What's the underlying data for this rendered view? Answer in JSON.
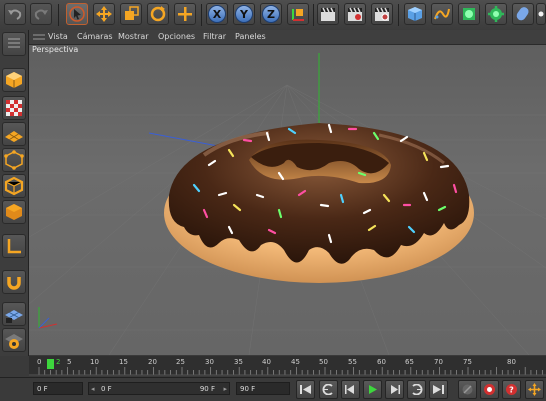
{
  "menu": {
    "items": [
      "Vista",
      "Cámaras",
      "Mostrar",
      "Opciones",
      "Filtrar",
      "Paneles"
    ]
  },
  "viewport": {
    "label": "Perspectiva"
  },
  "toolbar": {
    "axis_x": "X",
    "axis_y": "Y",
    "axis_z": "Z"
  },
  "timeline": {
    "ticks": [
      "0",
      "5",
      "10",
      "15",
      "20",
      "25",
      "30",
      "35",
      "40",
      "45",
      "50",
      "55",
      "60",
      "65",
      "70",
      "75",
      "80"
    ],
    "current_frame": "2"
  },
  "transport": {
    "start_field": "0 F",
    "range_start": "0 F",
    "range_end": "90 F",
    "end_field": "90 F"
  },
  "colors": {
    "accent_orange": "#f5a623",
    "playhead_green": "#3dd63d",
    "axis_x_red": "#d23030",
    "axis_y_green": "#2fb82f",
    "axis_z_blue": "#3a5fd6"
  }
}
